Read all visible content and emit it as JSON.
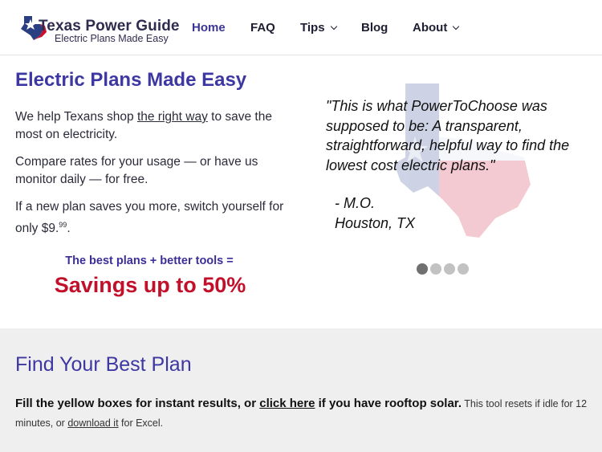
{
  "header": {
    "logo_title": "Texas Power Guide",
    "logo_tagline": "Electric Plans Made Easy",
    "nav": [
      {
        "label": "Home",
        "active": true,
        "dropdown": false
      },
      {
        "label": "FAQ",
        "active": false,
        "dropdown": false
      },
      {
        "label": "Tips",
        "active": false,
        "dropdown": true
      },
      {
        "label": "Blog",
        "active": false,
        "dropdown": false
      },
      {
        "label": "About",
        "active": false,
        "dropdown": true
      }
    ]
  },
  "hero": {
    "title": "Electric Plans Made Easy",
    "p1_before": "We help Texans shop ",
    "p1_link": "the right way",
    "p1_after": " to save the most on electricity.",
    "p2": "Compare rates for your usage — or have us monitor daily — for free.",
    "p3_before": "If a new plan saves you more, switch yourself for only $9.",
    "p3_sup": "99",
    "p3_after": ".",
    "best_line": "The best plans + better tools =",
    "savings_line": "Savings up to 50%"
  },
  "testimonial": {
    "quote": "\"This is what PowerToChoose was supposed to be: A transparent, straightforward, helpful way to find the lowest cost electric plans.\"",
    "author_name": "- M.O.",
    "author_location": "Houston, TX",
    "slide_count": 4,
    "active_slide": 1
  },
  "find_plan": {
    "title": "Find Your Best Plan",
    "text_bold_1": "Fill the yellow boxes for instant results, or ",
    "link_click_here": "click here",
    "text_bold_2": " if you have rooftop solar.",
    "text_small_1": " This tool resets if idle for 12 minutes, or ",
    "link_download": "download it",
    "text_small_2": " for Excel."
  },
  "colors": {
    "brand_purple": "#3d37a2",
    "savings_red": "#c2102b",
    "lower_bg": "#efefef"
  },
  "icons": [
    "texas-star-logo-icon",
    "chevron-down-icon",
    "texas-map-flag-icon"
  ]
}
